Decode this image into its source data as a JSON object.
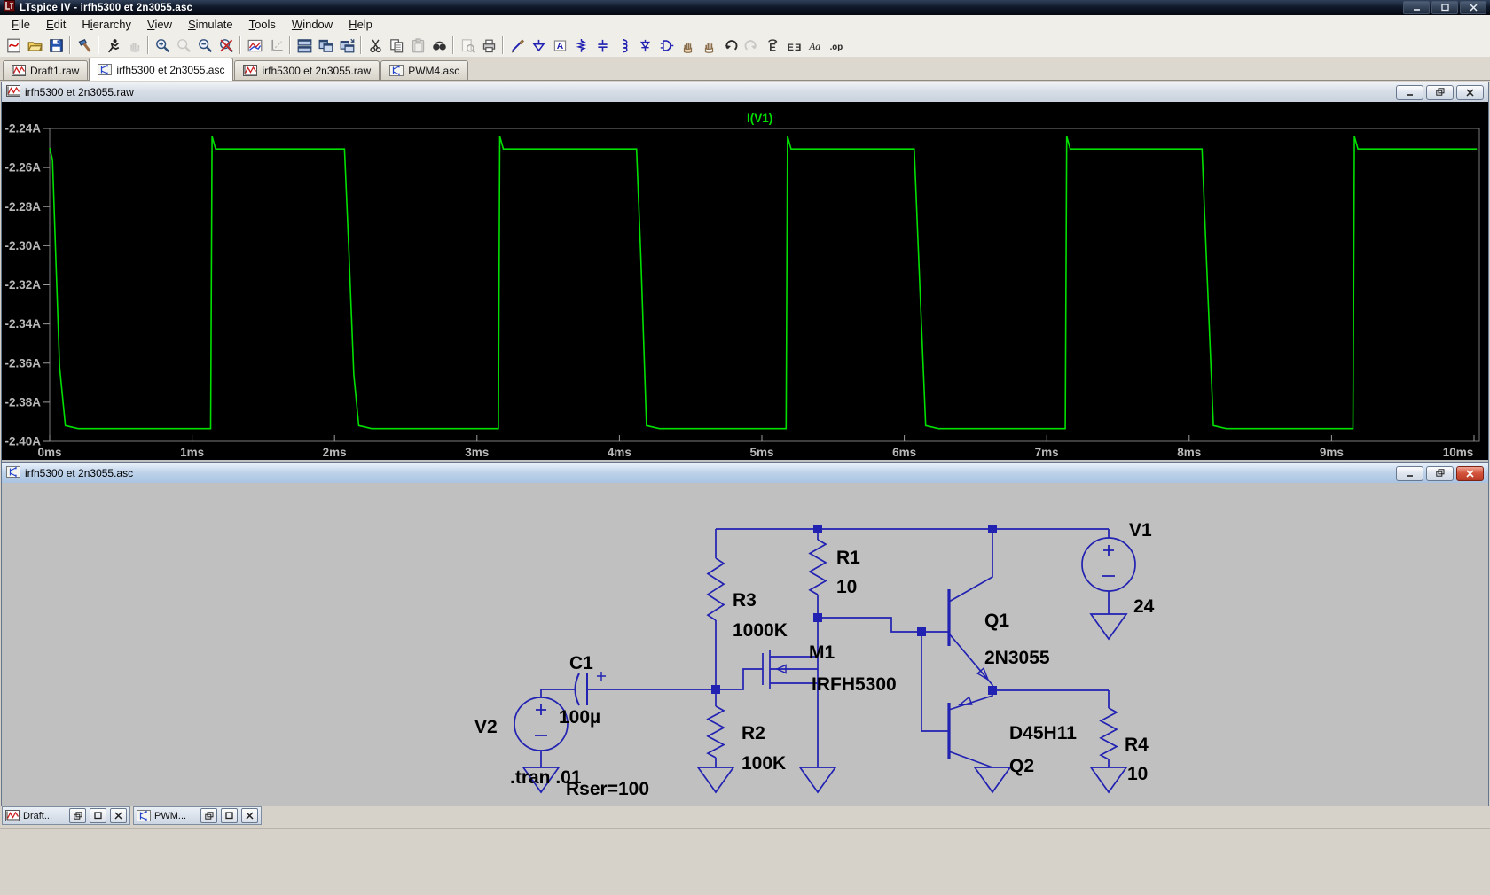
{
  "app": {
    "title": "LTspice IV - irfh5300 et 2n3055.asc",
    "window_controls": [
      "minimize",
      "maximize",
      "close"
    ]
  },
  "menu": {
    "items": [
      {
        "label": "File",
        "accel_index": 0
      },
      {
        "label": "Edit",
        "accel_index": 0
      },
      {
        "label": "Hierarchy",
        "accel_index": 1
      },
      {
        "label": "View",
        "accel_index": 0
      },
      {
        "label": "Simulate",
        "accel_index": 0
      },
      {
        "label": "Tools",
        "accel_index": 0
      },
      {
        "label": "Window",
        "accel_index": 0
      },
      {
        "label": "Help",
        "accel_index": 0
      }
    ]
  },
  "toolbar": {
    "groups": [
      [
        "new-schematic",
        "open-file",
        "save"
      ],
      [
        "control-panel"
      ],
      [
        "run-simulation",
        "halt-simulation"
      ],
      [
        "zoom-in",
        "zoom-previous",
        "zoom-out",
        "zoom-full-extents"
      ],
      [
        "plot-settings",
        "autorange-y"
      ],
      [
        "tile-horizontal",
        "tile-vertical",
        "cascade-windows"
      ],
      [
        "cut",
        "copy",
        "paste",
        "find"
      ],
      [
        "print-preview",
        "print"
      ],
      [
        "draw-wire",
        "place-ground",
        "place-label",
        "place-resistor",
        "place-capacitor",
        "place-inductor",
        "place-diode",
        "place-component",
        "move",
        "drag",
        "undo",
        "redo",
        "rotate",
        "mirror",
        "place-text",
        "spice-directive"
      ]
    ],
    "disabled": [
      "halt-simulation",
      "zoom-previous",
      "paste",
      "redo",
      "print-preview"
    ]
  },
  "tabs": [
    {
      "label": "Draft1.raw",
      "icon": "waveform",
      "active": false
    },
    {
      "label": "irfh5300 et 2n3055.asc",
      "icon": "schematic",
      "active": true
    },
    {
      "label": "irfh5300 et 2n3055.raw",
      "icon": "waveform",
      "active": false
    },
    {
      "label": "PWM4.asc",
      "icon": "schematic",
      "active": false
    }
  ],
  "waveform_window": {
    "title": "irfh5300 et 2n3055.raw",
    "legend": "I(V1)",
    "controls": [
      "minimize",
      "restore",
      "close"
    ]
  },
  "chart_data": {
    "type": "line",
    "title": "I(V1)",
    "grid": false,
    "legend_position": "top-center",
    "x_unit": "ms",
    "y_unit": "A",
    "x_range_ms": [
      0,
      10.04
    ],
    "y_range_A": [
      -2.4037,
      -2.24
    ],
    "x_ticks": [
      "0ms",
      "1ms",
      "2ms",
      "3ms",
      "4ms",
      "5ms",
      "6ms",
      "7ms",
      "8ms",
      "9ms",
      "10ms"
    ],
    "y_ticks": [
      "-2.24A",
      "-2.26A",
      "-2.28A",
      "-2.30A",
      "-2.32A",
      "-2.34A",
      "-2.36A",
      "-2.38A",
      "-2.40A"
    ],
    "series": [
      {
        "name": "I(V1)",
        "color": "#00df00",
        "points_ms_A": [
          [
            0,
            -2.25
          ],
          [
            0.02,
            -2.256
          ],
          [
            0.045,
            -2.31
          ],
          [
            0.07,
            -2.362
          ],
          [
            0.11,
            -2.392
          ],
          [
            0.2,
            -2.3935
          ],
          [
            1.13,
            -2.3935
          ],
          [
            1.14,
            -2.244
          ],
          [
            1.165,
            -2.2505
          ],
          [
            2.07,
            -2.2505
          ],
          [
            2.1,
            -2.302
          ],
          [
            2.135,
            -2.366
          ],
          [
            2.17,
            -2.392
          ],
          [
            2.26,
            -2.3935
          ],
          [
            3.15,
            -2.3935
          ],
          [
            3.16,
            -2.244
          ],
          [
            3.185,
            -2.2505
          ],
          [
            4.12,
            -2.2505
          ],
          [
            4.15,
            -2.305
          ],
          [
            4.19,
            -2.392
          ],
          [
            4.28,
            -2.3935
          ],
          [
            5.17,
            -2.3935
          ],
          [
            5.18,
            -2.244
          ],
          [
            5.205,
            -2.2505
          ],
          [
            6.07,
            -2.2505
          ],
          [
            6.1,
            -2.305
          ],
          [
            6.15,
            -2.392
          ],
          [
            6.24,
            -2.3935
          ],
          [
            7.13,
            -2.3935
          ],
          [
            7.14,
            -2.244
          ],
          [
            7.165,
            -2.2505
          ],
          [
            8.09,
            -2.2505
          ],
          [
            8.12,
            -2.305
          ],
          [
            8.17,
            -2.392
          ],
          [
            8.26,
            -2.3935
          ],
          [
            9.15,
            -2.3935
          ],
          [
            9.16,
            -2.244
          ],
          [
            9.185,
            -2.2505
          ],
          [
            10.02,
            -2.2505
          ]
        ]
      }
    ]
  },
  "schematic_window": {
    "title": "irfh5300 et 2n3055.asc",
    "controls": [
      "minimize",
      "restore",
      "close"
    ],
    "components": [
      {
        "key": "V1",
        "ref": "V1",
        "value": "24"
      },
      {
        "key": "V2",
        "ref": "V2",
        "value": ""
      },
      {
        "key": "C1",
        "ref": "C1",
        "value": "100µ"
      },
      {
        "key": "R1",
        "ref": "R1",
        "value": "10"
      },
      {
        "key": "R2",
        "ref": "R2",
        "value": "100K"
      },
      {
        "key": "R3",
        "ref": "R3",
        "value": "1000K"
      },
      {
        "key": "R4",
        "ref": "R4",
        "value": "10"
      },
      {
        "key": "M1",
        "ref": "M1",
        "value": "IRFH5300"
      },
      {
        "key": "Q1",
        "ref": "Q1",
        "value": "2N3055"
      },
      {
        "key": "Q2",
        "ref": "Q2",
        "value": "D45H11"
      }
    ],
    "directives": [
      {
        "text": ".tran .01"
      },
      {
        "text": "Rser=100"
      }
    ]
  },
  "minimized_windows": [
    {
      "label": "Draft...",
      "icon": "waveform",
      "controls": [
        "restore",
        "maximize",
        "close"
      ]
    },
    {
      "label": "PWM...",
      "icon": "schematic",
      "controls": [
        "restore",
        "maximize",
        "close"
      ]
    }
  ],
  "colors": {
    "trace": "#00df00",
    "schematic_wire": "#2121b2",
    "plot_background": "#000000",
    "schematic_background": "#c0c0c0",
    "axis_text": "#b9b9b9"
  }
}
